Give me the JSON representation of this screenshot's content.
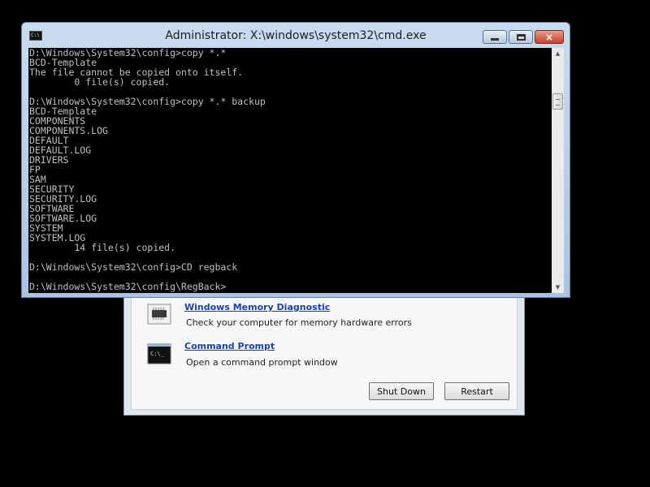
{
  "cmd_window": {
    "title": "Administrator: X:\\windows\\system32\\cmd.exe",
    "sys_icon": "C:\\",
    "console_lines": [
      "D:\\Windows\\System32\\config>copy *.*",
      "BCD-Template",
      "The file cannot be copied onto itself.",
      "        0 file(s) copied.",
      "",
      "D:\\Windows\\System32\\config>copy *.* backup",
      "BCD-Template",
      "COMPONENTS",
      "COMPONENTS.LOG",
      "DEFAULT",
      "DEFAULT.LOG",
      "DRIVERS",
      "FP",
      "SAM",
      "SECURITY",
      "SECURITY.LOG",
      "SOFTWARE",
      "SOFTWARE.LOG",
      "SYSTEM",
      "SYSTEM.LOG",
      "        14 file(s) copied.",
      "",
      "D:\\Windows\\System32\\config>CD regback",
      "",
      "D:\\Windows\\System32\\config\\RegBack>"
    ],
    "caption_buttons": {
      "minimize": "minimize-icon",
      "maximize": "maximize-icon",
      "close": "×"
    }
  },
  "recovery_options": {
    "items": [
      {
        "title": "Windows Memory Diagnostic",
        "description": "Check your computer for memory hardware errors",
        "icon": "memory-chip-icon"
      },
      {
        "title": "Command Prompt",
        "description": "Open a command prompt window",
        "icon": "command-prompt-icon",
        "icon_text": "C:\\_"
      }
    ],
    "shutdown_label": "Shut Down",
    "restart_label": "Restart"
  }
}
